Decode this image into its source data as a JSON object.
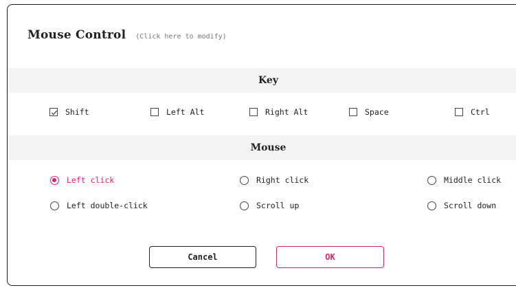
{
  "dialog": {
    "title": "Mouse Control",
    "hint": "(Click here to modify)"
  },
  "key_section": {
    "header": "Key",
    "options": [
      {
        "label": "Shift",
        "checked": true
      },
      {
        "label": "Left Alt",
        "checked": false
      },
      {
        "label": "Right Alt",
        "checked": false
      },
      {
        "label": "Space",
        "checked": false
      },
      {
        "label": "Ctrl",
        "checked": false
      }
    ]
  },
  "mouse_section": {
    "header": "Mouse",
    "options": [
      {
        "label": "Left click",
        "selected": true
      },
      {
        "label": "Right click",
        "selected": false
      },
      {
        "label": "Middle click",
        "selected": false
      },
      {
        "label": "Left double-click",
        "selected": false
      },
      {
        "label": "Scroll up",
        "selected": false
      },
      {
        "label": "Scroll down",
        "selected": false
      }
    ]
  },
  "buttons": {
    "cancel": "Cancel",
    "ok": "OK"
  },
  "colors": {
    "accent": "#d6246e",
    "section_background": "#f3f3f3",
    "border": "#1a1a1a"
  },
  "icons": {
    "checkbox_checked": "check-icon"
  }
}
